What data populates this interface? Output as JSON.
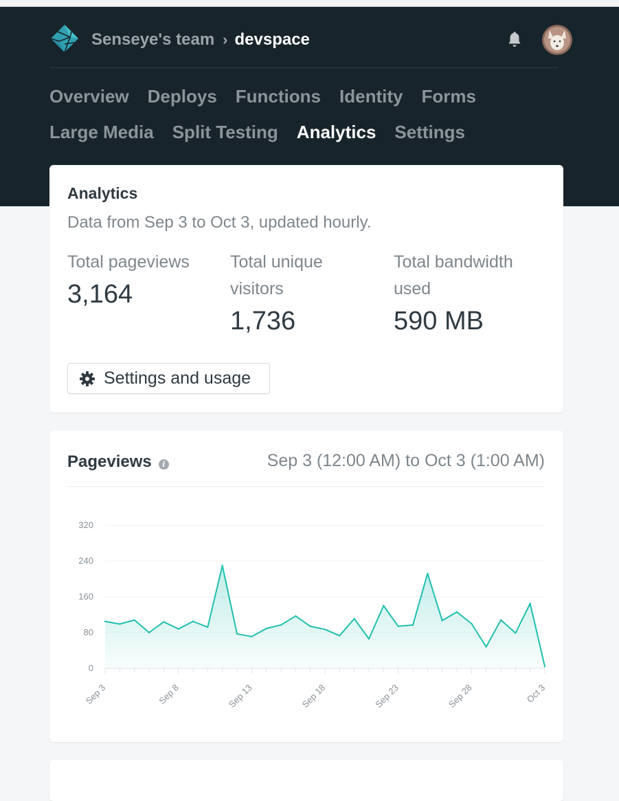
{
  "header": {
    "team": "Senseye's team",
    "separator": "›",
    "site": "devspace"
  },
  "nav": {
    "row1": [
      "Overview",
      "Deploys",
      "Functions",
      "Identity",
      "Forms"
    ],
    "row2": [
      "Large Media",
      "Split Testing",
      "Analytics",
      "Settings"
    ],
    "active": "Analytics"
  },
  "analytics": {
    "title": "Analytics",
    "subtitle": "Data from Sep 3 to Oct 3, updated hourly.",
    "stats": [
      {
        "label": "Total pageviews",
        "value": "3,164"
      },
      {
        "label": "Total unique visitors",
        "value": "1,736"
      },
      {
        "label": "Total bandwidth used",
        "value": "590 MB"
      }
    ],
    "settings_button": "Settings and usage"
  },
  "pageviews": {
    "title": "Pageviews",
    "range": "Sep 3 (12:00 AM) to Oct 3 (1:00 AM)"
  },
  "colors": {
    "header_bg": "#18242b",
    "accent": "#1fbfae",
    "page_bg": "#f4f6f8"
  },
  "icons": [
    "netlify-logo-icon",
    "bell-icon",
    "avatar",
    "gear-icon",
    "info-icon"
  ],
  "chart_data": {
    "type": "area",
    "title": "",
    "xlabel": "",
    "ylabel": "",
    "ylim": [
      0,
      320
    ],
    "yticks": [
      0,
      80,
      160,
      240,
      320
    ],
    "xtick_labels": [
      "Sep 3",
      "Sep 8",
      "Sep 13",
      "Sep 18",
      "Sep 23",
      "Sep 28",
      "Oct 3"
    ],
    "x": [
      "Sep 3",
      "Sep 4",
      "Sep 5",
      "Sep 6",
      "Sep 7",
      "Sep 8",
      "Sep 9",
      "Sep 10",
      "Sep 11",
      "Sep 12",
      "Sep 13",
      "Sep 14",
      "Sep 15",
      "Sep 16",
      "Sep 17",
      "Sep 18",
      "Sep 19",
      "Sep 20",
      "Sep 21",
      "Sep 22",
      "Sep 23",
      "Sep 24",
      "Sep 25",
      "Sep 26",
      "Sep 27",
      "Sep 28",
      "Sep 29",
      "Sep 30",
      "Oct 1",
      "Oct 2",
      "Oct 3"
    ],
    "values": [
      105,
      99,
      108,
      80,
      104,
      88,
      105,
      92,
      230,
      77,
      71,
      89,
      97,
      117,
      94,
      87,
      73,
      111,
      66,
      140,
      94,
      97,
      212,
      107,
      126,
      100,
      48,
      108,
      79,
      145,
      4
    ],
    "grid": true,
    "legend": "none"
  }
}
